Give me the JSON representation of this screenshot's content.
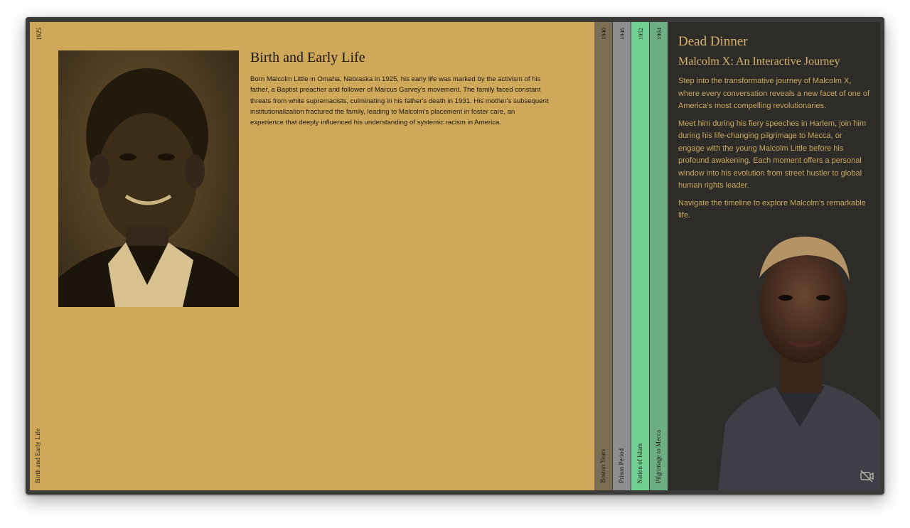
{
  "main": {
    "year": "1925",
    "era": "Birth and Early Life",
    "section_title": "Birth and Early Life",
    "section_body": "Born Malcolm Little in Omaha, Nebraska in 1925, his early life was marked by the activism of his father, a Baptist preacher and follower of Marcus Garvey's movement. The family faced constant threats from white supremacists, culminating in his father's death in 1931. His mother's subsequent institutionalization fractured the family, leading to Malcolm's placement in foster care, an experience that deeply influenced his understanding of systemic racism in America."
  },
  "timeline": [
    {
      "year": "1940",
      "label": "Boston Years",
      "color": "#7c6d55"
    },
    {
      "year": "1946",
      "label": "Prison Period",
      "color": "#8e8e8e"
    },
    {
      "year": "1952",
      "label": "Nation of Islam",
      "color": "#72cf92"
    },
    {
      "year": "1964",
      "label": "Pilgrimage to Mecca",
      "color": "#6dae85"
    }
  ],
  "sidebar": {
    "title": "Dead Dinner",
    "subtitle": "Malcolm X: An Interactive Journey",
    "paragraphs": [
      "Step into the transformative journey of Malcolm X, where every conversation reveals a new facet of one of America's most compelling revolutionaries.",
      "Meet him during his fiery speeches in Harlem, join him during his life-changing pilgrimage to Mecca, or engage with the young Malcolm Little before his profound awakening. Each moment offers a personal window into his evolution from street hustler to global human rights leader.",
      "Navigate the timeline to explore Malcolm's remarkable life."
    ],
    "camera_icon": "camera-off-icon"
  },
  "colors": {
    "main_bg": "#cfa85a",
    "sidebar_bg": "#2e2c28",
    "sidebar_text": "#c9a861",
    "frame": "#3a3a39"
  }
}
